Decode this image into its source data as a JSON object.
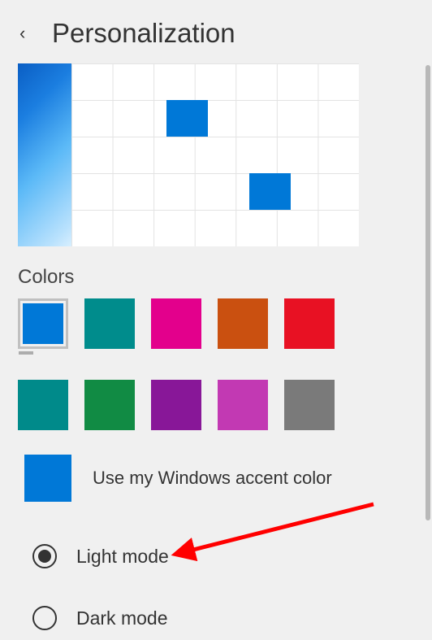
{
  "header": {
    "title": "Personalization"
  },
  "sections": {
    "colors_title": "Colors"
  },
  "swatches_row1": [
    {
      "name": "blue",
      "hex": "#0078d7",
      "selected": true
    },
    {
      "name": "teal",
      "hex": "#008c8c",
      "selected": false
    },
    {
      "name": "magenta",
      "hex": "#e3008c",
      "selected": false
    },
    {
      "name": "orange",
      "hex": "#ca5010",
      "selected": false
    },
    {
      "name": "red",
      "hex": "#e81123",
      "selected": false
    }
  ],
  "swatches_row2": [
    {
      "name": "dark-teal",
      "hex": "#008a8a",
      "selected": false
    },
    {
      "name": "green",
      "hex": "#118b44",
      "selected": false
    },
    {
      "name": "purple",
      "hex": "#881798",
      "selected": false
    },
    {
      "name": "pink",
      "hex": "#c239b3",
      "selected": false
    },
    {
      "name": "gray",
      "hex": "#7a7a7a",
      "selected": false
    }
  ],
  "accent": {
    "swatch_hex": "#0078d7",
    "label": "Use my Windows accent color"
  },
  "modes": {
    "light_label": "Light mode",
    "dark_label": "Dark mode",
    "selected": "light"
  },
  "annotation": {
    "type": "arrow",
    "color": "#ff0000",
    "points_to": "light-mode-option"
  }
}
